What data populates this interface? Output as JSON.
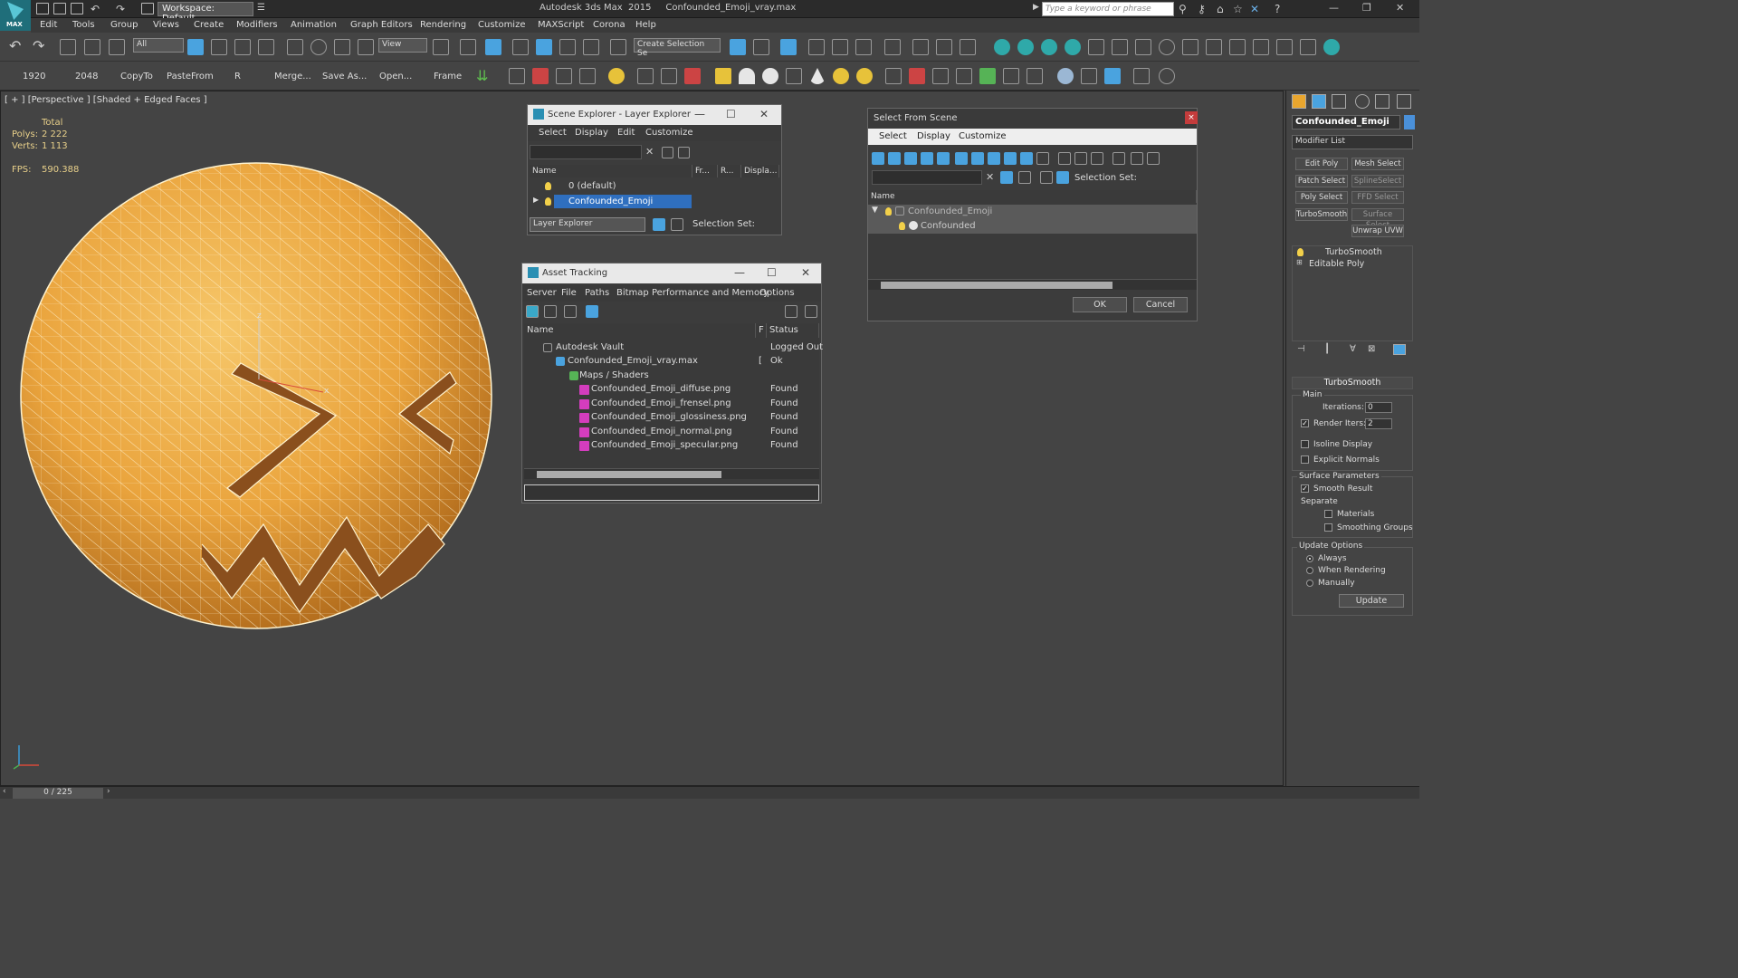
{
  "titlebar": {
    "logo_label": "MAX",
    "workspace": "Workspace: Default",
    "app_title": "Autodesk 3ds Max  2015     Confounded_Emoji_vray.max",
    "search_placeholder": "Type a keyword or phrase"
  },
  "menu": [
    "Edit",
    "Tools",
    "Group",
    "Views",
    "Create",
    "Modifiers",
    "Animation",
    "Graph Editors",
    "Rendering",
    "Customize",
    "MAXScript",
    "Corona",
    "Help"
  ],
  "toolbar1": {
    "selection_filter": "All",
    "ref_coord": "View",
    "named_selection": "Create Selection Se"
  },
  "toolbar2": {
    "labels": [
      "1920",
      "2048",
      "CopyTo",
      "PasteFrom",
      "R",
      "Merge...",
      "Save As...",
      "Open...",
      "Frame"
    ]
  },
  "viewport": {
    "label": "[ + ] [Perspective ] [Shaded + Edged Faces ]",
    "total_label": "Total",
    "polys_label": "Polys:",
    "polys_value": "2 222",
    "verts_label": "Verts:",
    "verts_value": "1 113",
    "fps_label": "FPS:",
    "fps_value": "590.388",
    "axis_z": "z",
    "axis_x": "x"
  },
  "trackbar": {
    "time": "0 / 225"
  },
  "command_panel": {
    "object_name": "Confounded_Emoji",
    "object_color": "#4a90d9",
    "modifier_list": "Modifier List",
    "modifier_buttons": [
      "Edit Poly",
      "Mesh Select",
      "Patch Select",
      "SplineSelect",
      "Poly Select",
      "FFD Select",
      "TurboSmooth",
      "Surface Select",
      "Unwrap UVW"
    ],
    "stack": [
      "TurboSmooth",
      "Editable Poly"
    ],
    "rollout": "TurboSmooth",
    "main_group": "Main",
    "iterations_label": "Iterations:",
    "iterations_value": "0",
    "render_iters_label": "Render Iters:",
    "render_iters_value": "2",
    "isoline": "Isoline Display",
    "explicit_normals": "Explicit Normals",
    "surface_params": "Surface Parameters",
    "smooth_result": "Smooth Result",
    "separate": "Separate",
    "materials": "Materials",
    "smoothing_groups": "Smoothing Groups",
    "update_options": "Update Options",
    "always": "Always",
    "when_rendering": "When Rendering",
    "manually": "Manually",
    "update_btn": "Update"
  },
  "scene_explorer": {
    "title": "Scene Explorer - Layer Explorer",
    "menu": [
      "Select",
      "Display",
      "Edit",
      "Customize"
    ],
    "headers": [
      "Name",
      "Fr...",
      "R...",
      "Displa..."
    ],
    "rows": [
      "0 (default)",
      "Confounded_Emoji"
    ],
    "footer_drop": "Layer Explorer",
    "footer_label": "Selection Set:"
  },
  "select_from_scene": {
    "title": "Select From Scene",
    "menu": [
      "Select",
      "Display",
      "Customize"
    ],
    "selection_set": "Selection Set:",
    "header_name": "Name",
    "rows": [
      "Confounded_Emoji",
      "Confounded"
    ],
    "ok": "OK",
    "cancel": "Cancel"
  },
  "asset_tracking": {
    "title": "Asset Tracking",
    "menu": [
      "Server",
      "File",
      "Paths",
      "Bitmap Performance and Memory",
      "Options"
    ],
    "headers": [
      "Name",
      "F",
      "Status"
    ],
    "rows": [
      {
        "name": "Autodesk Vault",
        "f": "",
        "status": "Logged Out"
      },
      {
        "name": "Confounded_Emoji_vray.max",
        "f": "[",
        "status": "Ok"
      },
      {
        "name": "Maps / Shaders",
        "f": "",
        "status": ""
      },
      {
        "name": "Confounded_Emoji_diffuse.png",
        "f": "",
        "status": "Found"
      },
      {
        "name": "Confounded_Emoji_frensel.png",
        "f": "",
        "status": "Found"
      },
      {
        "name": "Confounded_Emoji_glossiness.png",
        "f": "",
        "status": "Found"
      },
      {
        "name": "Confounded_Emoji_normal.png",
        "f": "",
        "status": "Found"
      },
      {
        "name": "Confounded_Emoji_specular.png",
        "f": "",
        "status": "Found"
      }
    ]
  }
}
